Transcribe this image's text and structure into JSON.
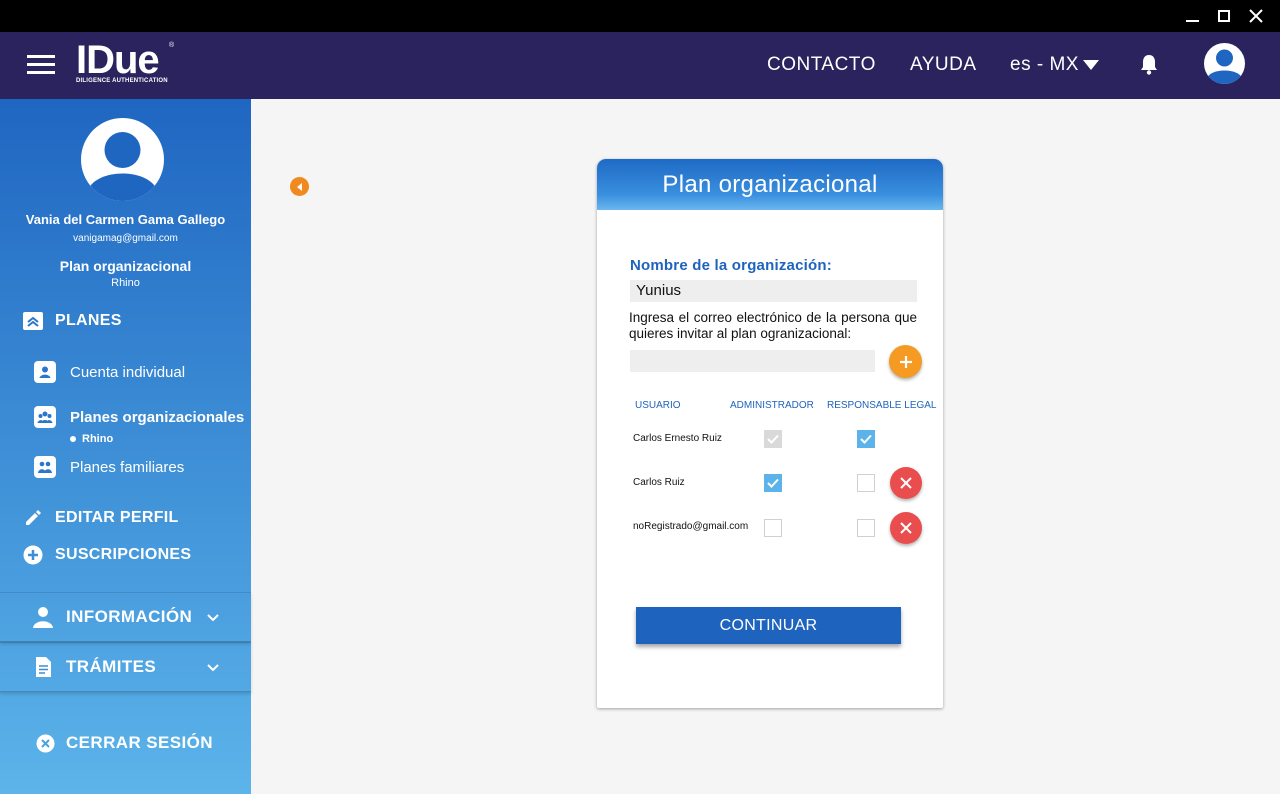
{
  "header": {
    "logo_main": "IDue",
    "logo_sub": "DILIGENCE AUTHENTICATION",
    "logo_mark": "®",
    "nav": {
      "contact": "CONTACTO",
      "help": "AYUDA",
      "language": "es - MX"
    }
  },
  "sidebar": {
    "user_name": "Vania del Carmen Gama Gallego",
    "user_email": "vanigamag@gmail.com",
    "plan_title": "Plan organizacional",
    "plan_name": "Rhino",
    "planes_label": "PLANES",
    "sub_items": [
      {
        "label": "Cuenta individual"
      },
      {
        "label": "Planes organizacionales",
        "child": "Rhino"
      },
      {
        "label": "Planes familiares"
      }
    ],
    "edit_profile": "EDITAR PERFIL",
    "subscriptions": "SUSCRIPCIONES",
    "information": "INFORMACIÓN",
    "procedures": "TRÁMITES",
    "logout": "CERRAR SESIÓN"
  },
  "card": {
    "title": "Plan organizacional",
    "org_label": "Nombre de la organización:",
    "org_value": "Yunius",
    "invite_label": "Ingresa el correo electrónico de la persona que quieres invitar al plan ogranizacional:",
    "invite_placeholder": "",
    "columns": {
      "user": "USUARIO",
      "admin": "ADMINISTRADOR",
      "legal": "RESPONSABLE LEGAL"
    },
    "rows": [
      {
        "user": "Carlos Ernesto Ruiz",
        "admin": "checked-disabled",
        "legal": "checked",
        "removable": false
      },
      {
        "user": "Carlos Ruiz",
        "admin": "checked",
        "legal": "unchecked",
        "removable": true
      },
      {
        "user": "noRegistrado@gmail.com",
        "admin": "unchecked",
        "legal": "unchecked",
        "removable": true
      }
    ],
    "continue_label": "CONTINUAR"
  },
  "colors": {
    "header_bg": "#2a235d",
    "primary_blue": "#1e63bd",
    "accent_orange": "#f59a22",
    "delete_red": "#ea4d4d",
    "check_blue": "#5bb3ea"
  }
}
